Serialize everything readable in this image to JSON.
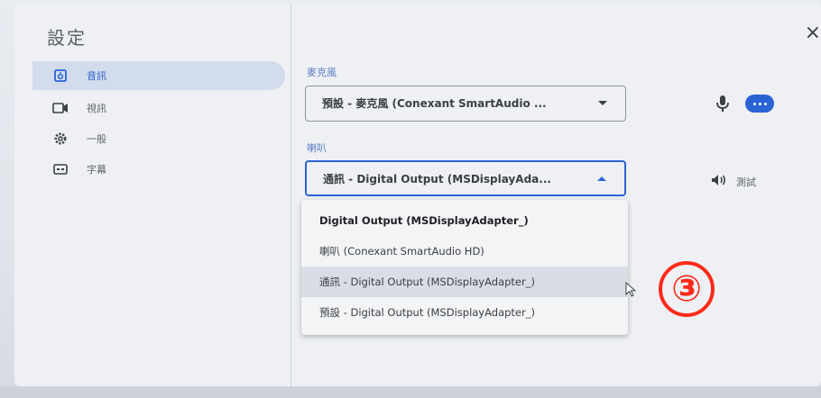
{
  "dialog": {
    "title": "設定",
    "close_glyph": "×"
  },
  "sidebar": {
    "items": [
      {
        "label": "音訊",
        "icon": "speaker-icon",
        "active": true
      },
      {
        "label": "視訊",
        "icon": "video-camera-icon",
        "active": false
      },
      {
        "label": "一般",
        "icon": "gear-icon",
        "active": false
      },
      {
        "label": "字幕",
        "icon": "closed-captions-icon",
        "active": false
      }
    ]
  },
  "microphone": {
    "section_label": "麥克風",
    "selected": "預設 - 麥克風 (Conexant SmartAudio ..."
  },
  "speaker": {
    "section_label": "喇叭",
    "selected": "通訊 - Digital Output (MSDisplayAda...",
    "test_label": "測試",
    "options": [
      "Digital Output (MSDisplayAdapter_)",
      "喇叭 (Conexant SmartAudio HD)",
      "通訊 - Digital Output (MSDisplayAdapter_)",
      "預設 - Digital Output (MSDisplayAdapter_)"
    ]
  },
  "annotation": {
    "step": "③",
    "color": "#ff2a1a"
  },
  "colors": {
    "accent": "#2a64d2",
    "active_nav_bg": "#d3dcec"
  }
}
